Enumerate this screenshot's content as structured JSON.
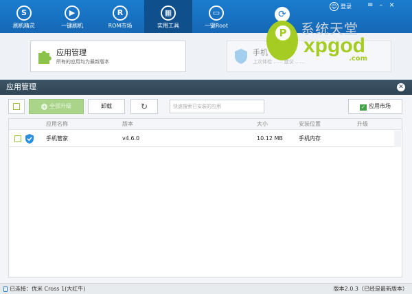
{
  "nav": {
    "items": [
      {
        "label": "刷机精灵",
        "glyph": "S",
        "icon": "shield-s-icon"
      },
      {
        "label": "一键刷机",
        "glyph": "▶",
        "icon": "play-arrow-icon"
      },
      {
        "label": "ROM市场",
        "glyph": "R",
        "icon": "rom-r-icon"
      },
      {
        "label": "实用工具",
        "glyph": "▦",
        "icon": "grid-tools-icon"
      },
      {
        "label": "一键Root",
        "glyph": "▭",
        "icon": "root-device-icon"
      }
    ],
    "active_index": 3,
    "center_icon": "refresh-swirl-icon",
    "login_label": "登录",
    "window_buttons": [
      "≡",
      "–",
      "×"
    ]
  },
  "features": {
    "app_manage": {
      "title": "应用管理",
      "subtitle": "所有的应用均为最新版本"
    },
    "phone_guard": {
      "title": "手机",
      "subtitle": "上次体检 ...... 建议 ......"
    }
  },
  "watermark": {
    "cn": "系统天堂",
    "en": "xpgod",
    "dom": ".com",
    "disc_letter": "P"
  },
  "dialog": {
    "title": "应用管理",
    "toolbar": {
      "upgrade_all": "全部升级",
      "uninstall": "卸载",
      "refresh_glyph": "↻",
      "search_placeholder": "快速搜索已安装的应用",
      "market": "应用市场"
    },
    "table": {
      "headers": {
        "name": "应用名称",
        "version": "版本",
        "size": "大小",
        "location": "安装位置",
        "upgrade": "升级"
      },
      "rows": [
        {
          "name": "手机管家",
          "version": "v4.6.0",
          "size": "10.12 MB",
          "location": "手机内存",
          "upgrade": ""
        }
      ]
    }
  },
  "status": {
    "connection": "已连接：优米 Cross 1(大红牛)",
    "version": "版本2.0.3（已经是最新版本）"
  },
  "colors": {
    "nav_blue": "#1b7ccf",
    "nav_active": "#0e4f8c",
    "dialog_title": "#2f4555",
    "accent_green": "#a5cc22"
  }
}
